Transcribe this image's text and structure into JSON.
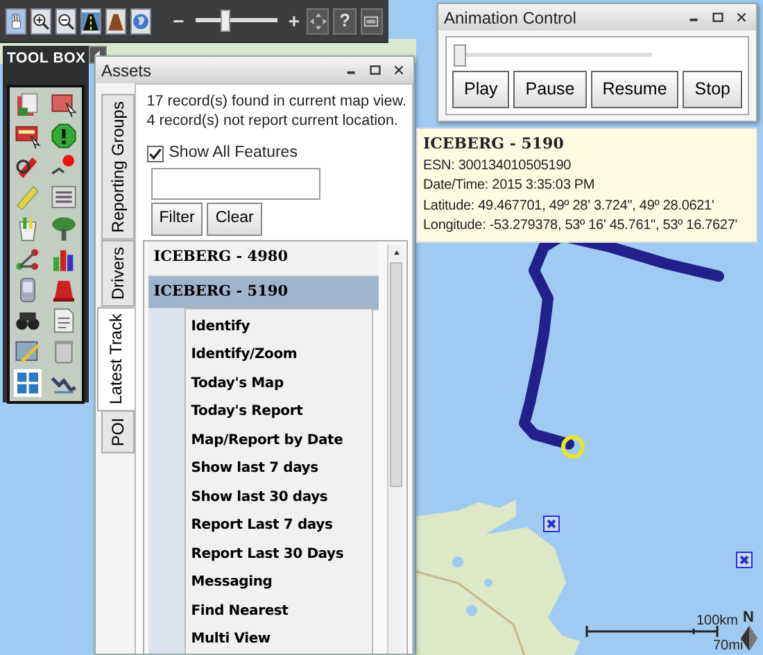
{
  "toolbar": {
    "zoom_slider": {
      "minus": "−",
      "plus": "+",
      "level": 0.35
    },
    "help": "?"
  },
  "toolbox": {
    "title": "TOOL BOX"
  },
  "assets_window": {
    "title": "Assets",
    "tabs": [
      {
        "label": "Reporting Groups",
        "selected": false
      },
      {
        "label": "Drivers",
        "selected": false
      },
      {
        "label": "Latest Track",
        "selected": true
      },
      {
        "label": "POI",
        "selected": false
      }
    ],
    "summary": [
      "17 record(s) found in current map view.",
      "4 record(s) not report current location."
    ],
    "show_all": {
      "label": "Show All Features",
      "checked": true
    },
    "buttons": [
      "Filter",
      "Clear"
    ],
    "assets": [
      {
        "name": "ICEBERG - 4980",
        "selected": false
      },
      {
        "name": "ICEBERG - 5190",
        "selected": true
      }
    ],
    "context_menu": [
      "Identify",
      "Identify/Zoom",
      "Today's Map",
      "Today's Report",
      "Map/Report by Date",
      "Show last 7 days",
      "Show last 30 days",
      "Report Last 7 days",
      "Report Last 30 Days",
      "Messaging",
      "Find Nearest",
      "Multi View"
    ]
  },
  "animation_control": {
    "title": "Animation Control",
    "level": 0.0,
    "buttons": [
      "Play",
      "Pause",
      "Resume",
      "Stop"
    ]
  },
  "info_popup": {
    "title": "ICEBERG - 5190",
    "lines": [
      "ESN: 300134010505190",
      "Date/Time:  2015 3:35:03 PM",
      "Latitude: 49.467701, 49º 28' 3.724\", 49º 28.0621'",
      "Longitude: -53.279378, 53º 16' 45.761\", 53º 16.7627'"
    ]
  },
  "map": {
    "scale_km": "100km",
    "scale_mi": "70mi",
    "north": "N"
  }
}
